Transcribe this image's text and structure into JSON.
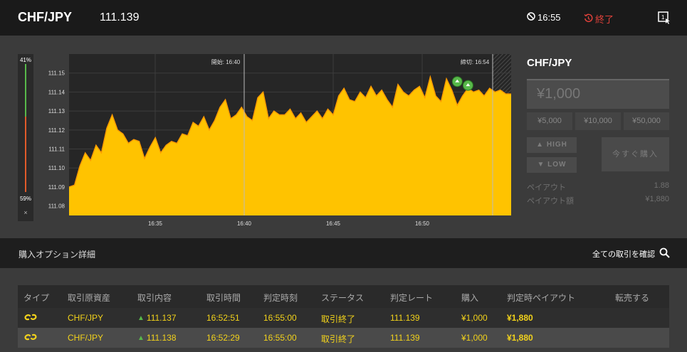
{
  "header": {
    "pair": "CHF/JPY",
    "rate": "111.139",
    "time": "16:55",
    "status": "終了"
  },
  "gauge": {
    "high_pct_label": "41%",
    "low_pct_label": "59%",
    "high_fraction": 0.41,
    "low_fraction": 0.59,
    "close_label": "×"
  },
  "chart_data": {
    "type": "area",
    "start_label": "開始: 16:40",
    "end_label": "締切: 16:54",
    "x_ticks": [
      "16:35",
      "16:40",
      "16:45",
      "16:50"
    ],
    "y_ticks": [
      "111.15",
      "111.14",
      "111.13",
      "111.12",
      "111.11",
      "111.10",
      "111.09",
      "111.08"
    ],
    "ylim": [
      111.075,
      111.16
    ],
    "grid": true,
    "series": [
      {
        "values": [
          111.09,
          111.091,
          111.101,
          111.108,
          111.104,
          111.112,
          111.108,
          111.121,
          111.128,
          111.12,
          111.118,
          111.113,
          111.115,
          111.114,
          111.105,
          111.111,
          111.116,
          111.108,
          111.112,
          111.114,
          111.113,
          111.118,
          111.117,
          111.124,
          111.122,
          111.127,
          111.12,
          111.125,
          111.132,
          111.136,
          111.126,
          111.128,
          111.132,
          111.127,
          111.125,
          111.137,
          111.14,
          111.126,
          111.13,
          111.128,
          111.128,
          111.131,
          111.126,
          111.129,
          111.124,
          111.127,
          111.13,
          111.126,
          111.131,
          111.128,
          111.138,
          111.142,
          111.136,
          111.135,
          111.14,
          111.137,
          111.143,
          111.138,
          111.141,
          111.136,
          111.132,
          111.144,
          111.14,
          111.138,
          111.141,
          111.143,
          111.137,
          111.148,
          111.138,
          111.135,
          111.147,
          111.141,
          111.133,
          111.138,
          111.142,
          111.14,
          111.141,
          111.138,
          111.142,
          111.14,
          111.141,
          111.139,
          111.139
        ]
      }
    ],
    "markers": [
      {
        "x_index": 72,
        "value": 111.144,
        "direction": "HIGH"
      },
      {
        "x_index": 74,
        "value": 111.142,
        "direction": "HIGH"
      }
    ]
  },
  "trade_panel": {
    "pair": "CHF/JPY",
    "amount": "¥1,000",
    "presets": [
      "¥5,000",
      "¥10,000",
      "¥50,000"
    ],
    "high_label": "HIGH",
    "low_label": "LOW",
    "buy_now_label": "今すぐ購入",
    "payout_label": "ペイアウト",
    "payout_value": "1.88",
    "payout_amount_label": "ペイアウト額",
    "payout_amount_value": "¥1,880"
  },
  "section": {
    "title": "購入オプション詳細",
    "view_all": "全ての取引を確認"
  },
  "table": {
    "columns": [
      "タイプ",
      "取引原資産",
      "取引内容",
      "取引時間",
      "判定時刻",
      "ステータス",
      "判定レート",
      "購入",
      "判定時ペイアウト",
      "転売する"
    ],
    "rows": [
      {
        "asset": "CHF/JPY",
        "content": "111.137",
        "time": "16:52:51",
        "expiry": "16:55:00",
        "status": "取引終了",
        "rate": "111.139",
        "amount": "¥1,000",
        "payout": "¥1,880"
      },
      {
        "asset": "CHF/JPY",
        "content": "111.138",
        "time": "16:52:29",
        "expiry": "16:55:00",
        "status": "取引終了",
        "rate": "111.139",
        "amount": "¥1,000",
        "payout": "¥1,880"
      }
    ]
  },
  "colors": {
    "accent": "#f2d21b",
    "area_fill": "#ffc300",
    "high": "#58b84a",
    "low": "#e05a2a",
    "ended": "#e0413a"
  }
}
